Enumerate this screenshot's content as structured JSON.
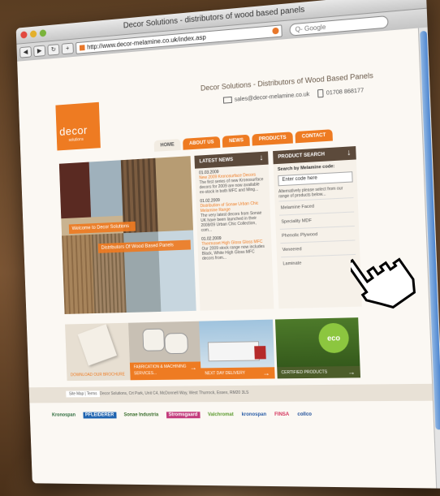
{
  "browser": {
    "window_title": "Decor Solutions - distributors of wood based panels",
    "url": "http://www.decor-melamine.co.uk/index.asp",
    "search_placeholder": "Q- Google",
    "nav_back": "◀",
    "nav_fwd": "▶",
    "reload": "↻",
    "add": "+"
  },
  "site": {
    "logo_word": "decor",
    "logo_sub": "solutions",
    "tagline": "Decor Solutions - Distributors of Wood Based Panels",
    "email": "sales@decor-melamine.co.uk",
    "phone": "01708 868177",
    "brand_color": "#ee7b22"
  },
  "tabs": [
    "HOME",
    "ABOUT US",
    "NEWS",
    "PRODUCTS",
    "CONTACT"
  ],
  "hero": {
    "welcome": "Welcome to Decor Solutions",
    "distributors": "Distributors Of Wood Based Panels"
  },
  "news": {
    "heading": "LATEST NEWS",
    "items": [
      {
        "date": "01.03.2009",
        "title": "New 2009 Kronosurface Decors",
        "body": "The first series of new Kronosurface decors for 2009 are now available ex-stock in both MFC and Ming..."
      },
      {
        "date": "01.02.2009",
        "title": "Distribution of Sonae Urban Chic Melamine Range",
        "body": "The very latest decors from Sonae UK have been launched in their 2008/09 Urban Chic Collection, com..."
      },
      {
        "date": "01.02.2009",
        "title": "Thermoset High Gloss Gloss MFC",
        "body": "Our 2009 stock range now includes Black, White High Gloss MFC decors from..."
      }
    ]
  },
  "product_search": {
    "heading": "PRODUCT SEARCH",
    "subheading": "Search by Melamine code:",
    "input_placeholder": "Enter code here",
    "note": "Alternatively please select from our range of products below...",
    "links": [
      "Melamine Faced",
      "Speciality MDF",
      "Phenolic Plywood",
      "Veneered",
      "Laminate"
    ]
  },
  "promos": [
    {
      "caption": "DOWNLOAD OUR BROCHURE"
    },
    {
      "caption": "FABRICATION & MACHINING SERVICES..."
    },
    {
      "caption": "NEXT DAY DELIVERY"
    },
    {
      "caption": "CERTIFIED PRODUCTS",
      "badge": "eco"
    }
  ],
  "footer": {
    "links": "Site Map | Terms",
    "address": "Decor Solutions, Crt Park, Unit C4, McDonnell Way, West Thurrock, Essex, RM20 3LS"
  },
  "partners": [
    "Kronospan",
    "PFLEIDERER",
    "Sonae Industria",
    "Stromsgaard",
    "Valchromat",
    "kronospan",
    "FINSA",
    "collco"
  ]
}
